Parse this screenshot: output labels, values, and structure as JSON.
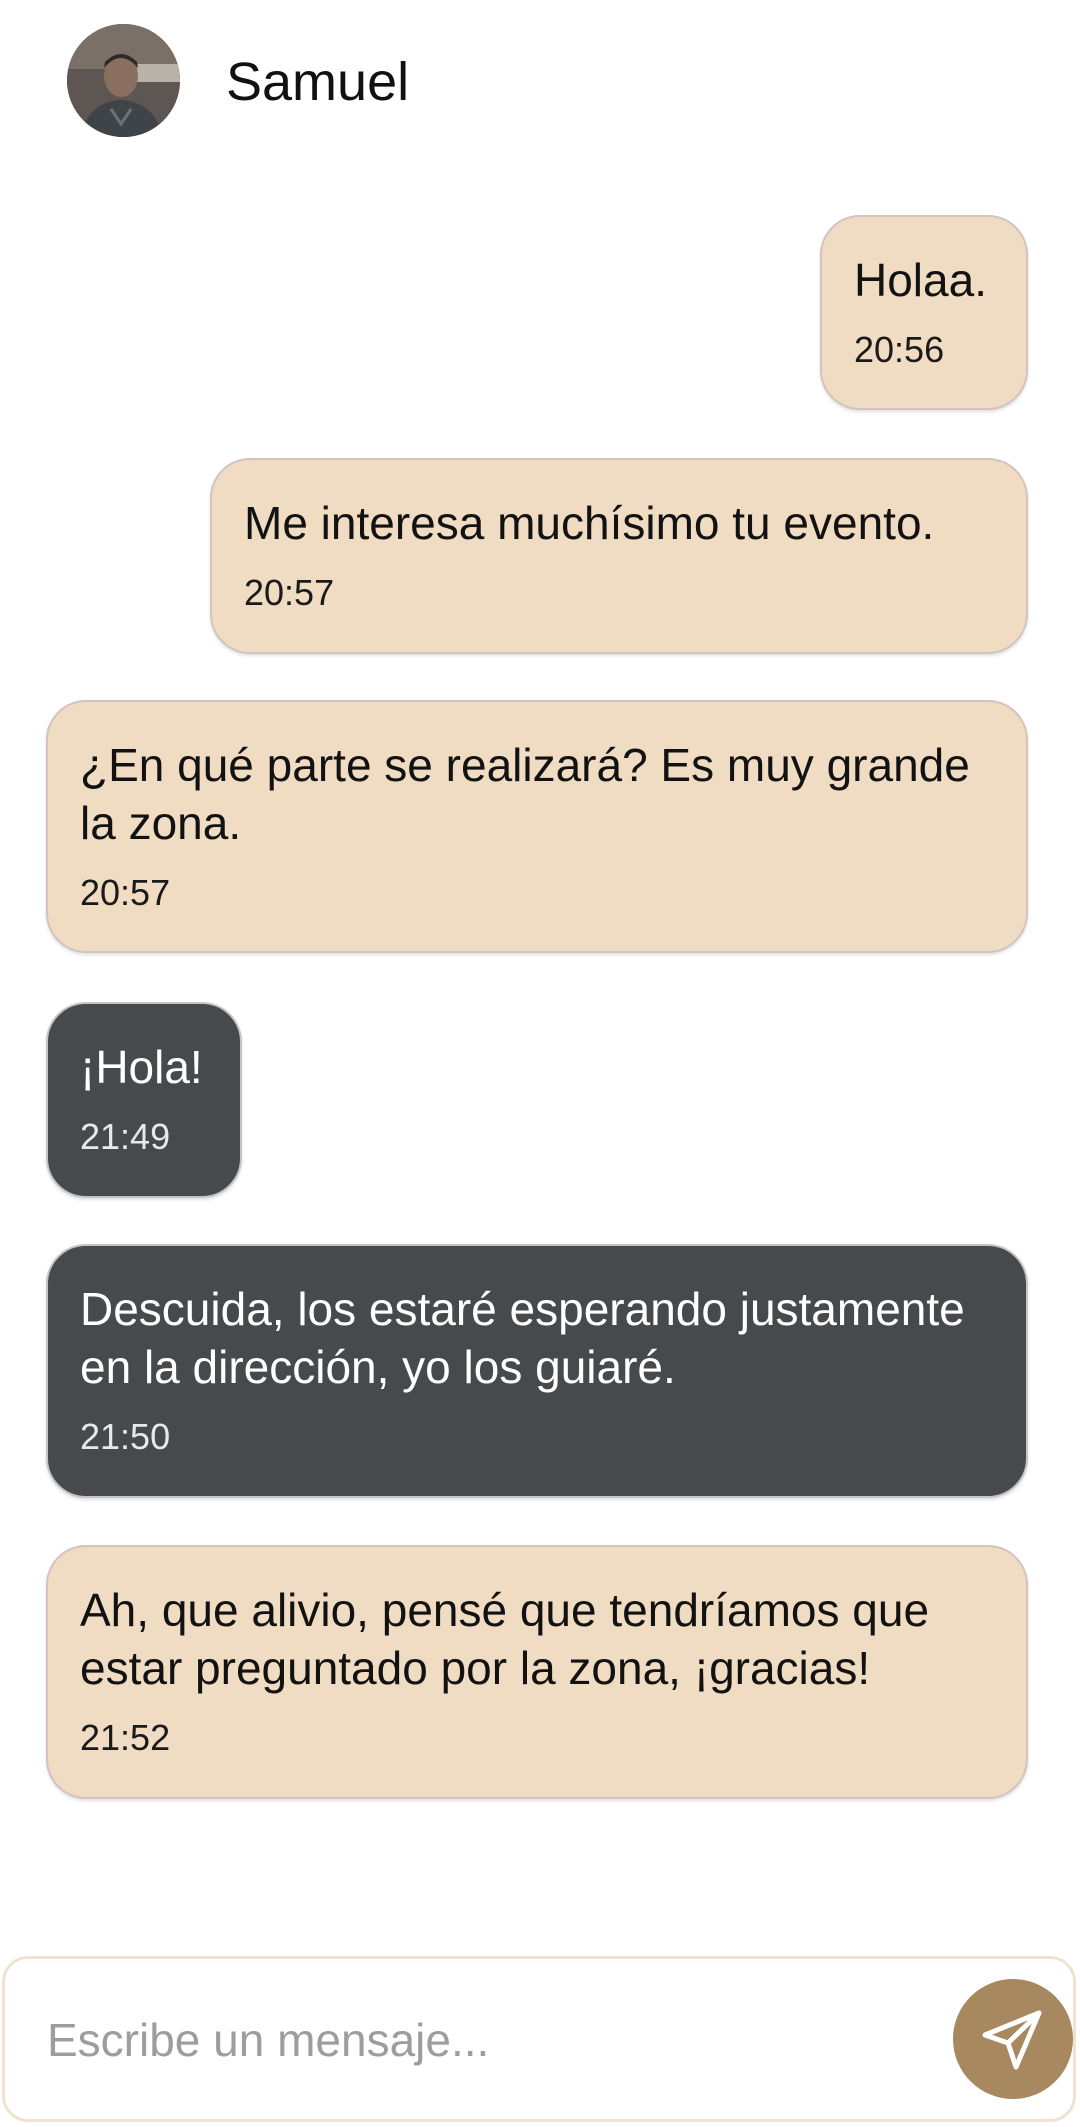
{
  "header": {
    "contact_name": "Samuel",
    "avatar_icon": "user-photo"
  },
  "messages": [
    {
      "text": "Holaa.",
      "time": "20:56",
      "side": "sent"
    },
    {
      "text": "Me interesa muchísimo tu evento.",
      "time": "20:57",
      "side": "sent"
    },
    {
      "text": "¿En qué parte se realizará? Es muy grande la zona.",
      "time": "20:57",
      "side": "sent"
    },
    {
      "text": "¡Hola!",
      "time": "21:49",
      "side": "received"
    },
    {
      "text": "Descuida, los estaré esperando justamente en la dirección, yo los guiaré.",
      "time": "21:50",
      "side": "received"
    },
    {
      "text": "Ah, que alivio, pensé que tendríamos que estar preguntado por la zona, ¡gracias!",
      "time": "21:52",
      "side": "sent"
    }
  ],
  "composer": {
    "placeholder": "Escribe un mensaje...",
    "value": "",
    "send_icon": "send-icon"
  },
  "colors": {
    "sent_bubble": "#f0dcc2",
    "received_bubble": "#474a4d",
    "send_button": "#a7885f"
  }
}
